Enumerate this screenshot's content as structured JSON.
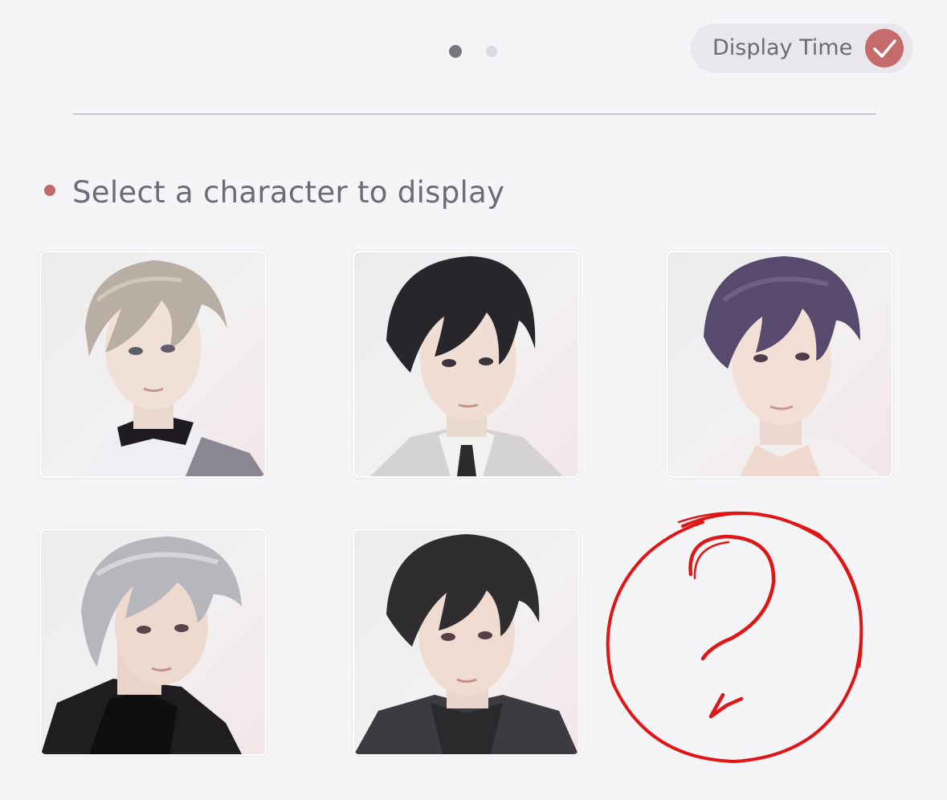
{
  "pager": {
    "total_pages": 2,
    "current_page": 1
  },
  "display_time": {
    "label": "Display Time",
    "checked": true,
    "accent_color": "#c56b6c"
  },
  "section": {
    "title": "Select a character to display",
    "bullet_color": "#bf6b68"
  },
  "characters": [
    {
      "hair_color": "#b8ada3",
      "outfit": "white jacket with black collar and grey vest"
    },
    {
      "hair_color": "#25252a",
      "outfit": "light grey suit with white shirt and black tie"
    },
    {
      "hair_color": "#57496b",
      "outfit": "white shirt"
    },
    {
      "hair_color": "#b3b2b8",
      "outfit": "black leather jacket"
    },
    {
      "hair_color": "#2f2c2e",
      "outfit": "dark hoodie"
    }
  ],
  "mystery_slot": {
    "mark_color": "#e01515"
  }
}
